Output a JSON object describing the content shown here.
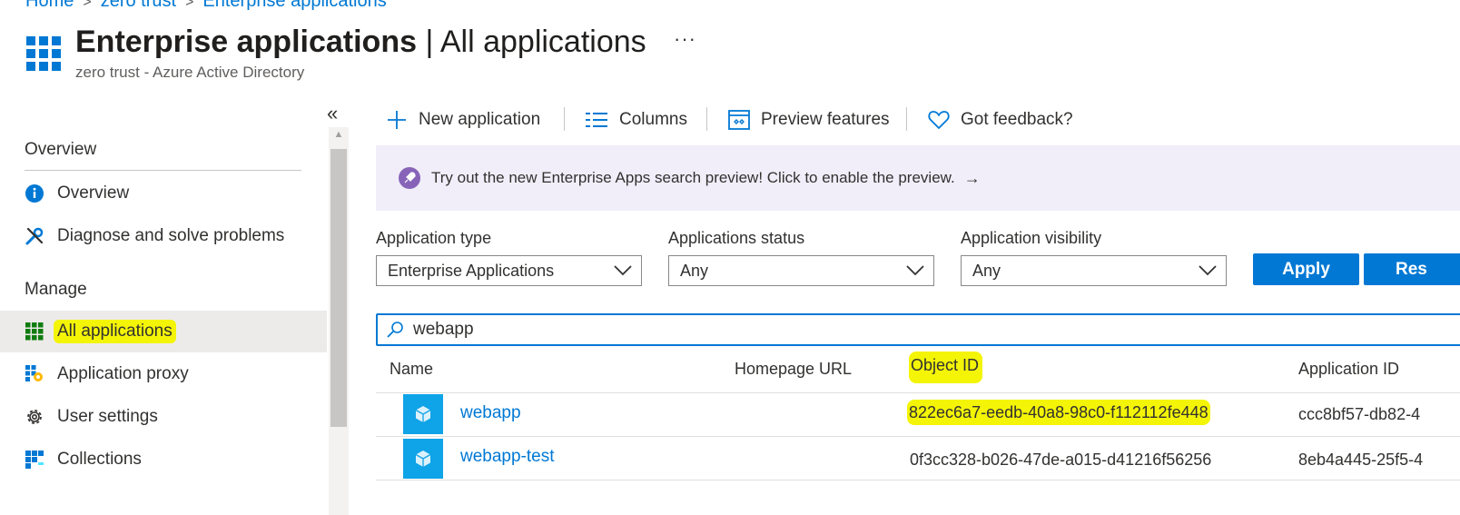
{
  "breadcrumb": [
    "Home",
    "zero trust",
    "Enterprise applications"
  ],
  "header": {
    "title": "Enterprise applications",
    "title_suffix": "| All applications",
    "more_label": "···",
    "subtitle": "zero trust - Azure Active Directory"
  },
  "nav": {
    "collapse_label": "«",
    "sections": [
      {
        "label": "Overview",
        "items": [
          {
            "label": "Overview",
            "icon": "info-icon"
          },
          {
            "label": "Diagnose and solve problems",
            "icon": "wrench-icon"
          }
        ]
      },
      {
        "label": "Manage",
        "items": [
          {
            "label": "All applications",
            "icon": "grid-apps-icon",
            "selected": true
          },
          {
            "label": "Application proxy",
            "icon": "app-proxy-icon"
          },
          {
            "label": "User settings",
            "icon": "gear-icon"
          },
          {
            "label": "Collections",
            "icon": "collections-icon"
          }
        ]
      }
    ]
  },
  "toolbar": {
    "new_application": "New application",
    "columns": "Columns",
    "preview_features": "Preview features",
    "feedback": "Got feedback?"
  },
  "banner": {
    "text": "Try out the new Enterprise Apps search preview! Click to enable the preview.",
    "arrow": "→"
  },
  "filters": {
    "app_type": {
      "label": "Application type",
      "value": "Enterprise Applications"
    },
    "app_status": {
      "label": "Applications status",
      "value": "Any"
    },
    "app_visibility": {
      "label": "Application visibility",
      "value": "Any"
    },
    "apply_label": "Apply",
    "reset_label": "Res"
  },
  "search": {
    "value": "webapp"
  },
  "table": {
    "columns": [
      "Name",
      "Homepage URL",
      "Object ID",
      "Application ID"
    ],
    "rows": [
      {
        "name": "webapp",
        "homepage": "",
        "object_id": "822ec6a7-eedb-40a8-98c0-f112112fe448",
        "app_id": "ccc8bf57-db82-4"
      },
      {
        "name": "webapp-test",
        "homepage": "",
        "object_id": "0f3cc328-b026-47de-a015-d41216f56256",
        "app_id": "8eb4a445-25f5-4"
      }
    ]
  },
  "colors": {
    "accent": "#0078d4",
    "highlight": "#f4f407",
    "banner_bg": "#f1eef9",
    "app_tile": "#0fa3e8"
  }
}
